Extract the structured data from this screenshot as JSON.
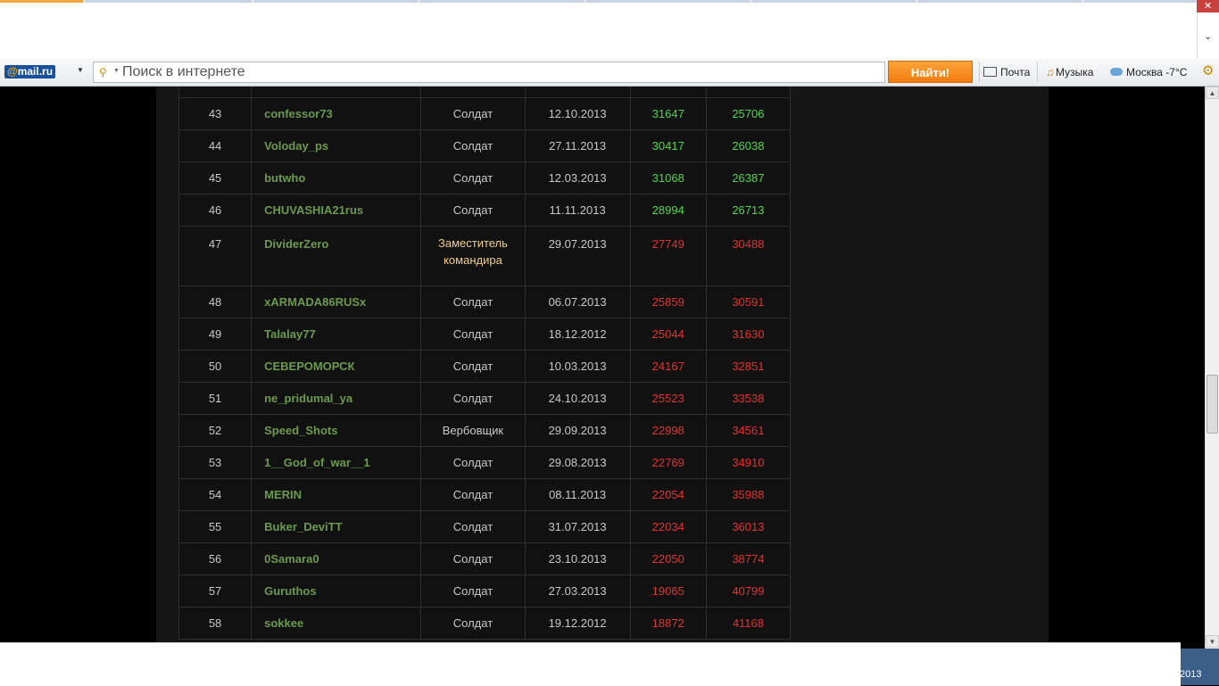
{
  "colors": {
    "positive": "#4fd64a",
    "negative": "#e3332e",
    "name": "#6c9a4d",
    "deputy": "#f0cf88",
    "find_button": "#f58a1f"
  },
  "window": {
    "close_label": "✕",
    "collapse_icon": "chevron-down-icon"
  },
  "toolbar": {
    "logo_at": "@",
    "logo_text": "mail.ru",
    "search_placeholder": "Поиск в интернете",
    "find_label": "Найти!",
    "mail_label": "Почта",
    "music_label": "Музыка",
    "weather_label": "Москва -7°C"
  },
  "table": {
    "rows": [
      {
        "num": "43",
        "name": "confessor73",
        "rank": "Солдат",
        "date": "12.10.2013",
        "v1": "31647",
        "v2": "25706",
        "color": "pos"
      },
      {
        "num": "44",
        "name": "Voloday_ps",
        "rank": "Солдат",
        "date": "27.11.2013",
        "v1": "30417",
        "v2": "26038",
        "color": "pos"
      },
      {
        "num": "45",
        "name": "butwho",
        "rank": "Солдат",
        "date": "12.03.2013",
        "v1": "31068",
        "v2": "26387",
        "color": "pos"
      },
      {
        "num": "46",
        "name": "CHUVASHIA21rus",
        "rank": "Солдат",
        "date": "11.11.2013",
        "v1": "28994",
        "v2": "26713",
        "color": "pos"
      },
      {
        "num": "47",
        "name": "DividerZero",
        "rank": "Заместитель командира",
        "date": "29.07.2013",
        "v1": "27749",
        "v2": "30488",
        "color": "neg"
      },
      {
        "num": "48",
        "name": "xARMADA86RUSx",
        "rank": "Солдат",
        "date": "06.07.2013",
        "v1": "25859",
        "v2": "30591",
        "color": "neg"
      },
      {
        "num": "49",
        "name": "Talalay77",
        "rank": "Солдат",
        "date": "18.12.2012",
        "v1": "25044",
        "v2": "31630",
        "color": "neg"
      },
      {
        "num": "50",
        "name": "СЕВЕРОМОРСК",
        "rank": "Солдат",
        "date": "10.03.2013",
        "v1": "24167",
        "v2": "32851",
        "color": "neg"
      },
      {
        "num": "51",
        "name": "ne_pridumal_ya",
        "rank": "Солдат",
        "date": "24.10.2013",
        "v1": "25523",
        "v2": "33538",
        "color": "neg"
      },
      {
        "num": "52",
        "name": "Speed_Shots",
        "rank": "Вербовщик",
        "date": "29.09.2013",
        "v1": "22998",
        "v2": "34561",
        "color": "neg"
      },
      {
        "num": "53",
        "name": "1__God_of_war__1",
        "rank": "Солдат",
        "date": "29.08.2013",
        "v1": "22769",
        "v2": "34910",
        "color": "neg"
      },
      {
        "num": "54",
        "name": "MERIN",
        "rank": "Солдат",
        "date": "08.11.2013",
        "v1": "22054",
        "v2": "35988",
        "color": "neg"
      },
      {
        "num": "55",
        "name": "Buker_DeviTT",
        "rank": "Солдат",
        "date": "31.07.2013",
        "v1": "22034",
        "v2": "36013",
        "color": "neg"
      },
      {
        "num": "56",
        "name": "0Samara0",
        "rank": "Солдат",
        "date": "23.10.2013",
        "v1": "22050",
        "v2": "38774",
        "color": "neg"
      },
      {
        "num": "57",
        "name": "Guruthos",
        "rank": "Солдат",
        "date": "27.03.2013",
        "v1": "19065",
        "v2": "40799",
        "color": "neg"
      },
      {
        "num": "58",
        "name": "sokkee",
        "rank": "Солдат",
        "date": "19.12.2012",
        "v1": "18872",
        "v2": "41168",
        "color": "neg"
      }
    ]
  },
  "taskbar": {
    "year_fragment": "2013"
  }
}
